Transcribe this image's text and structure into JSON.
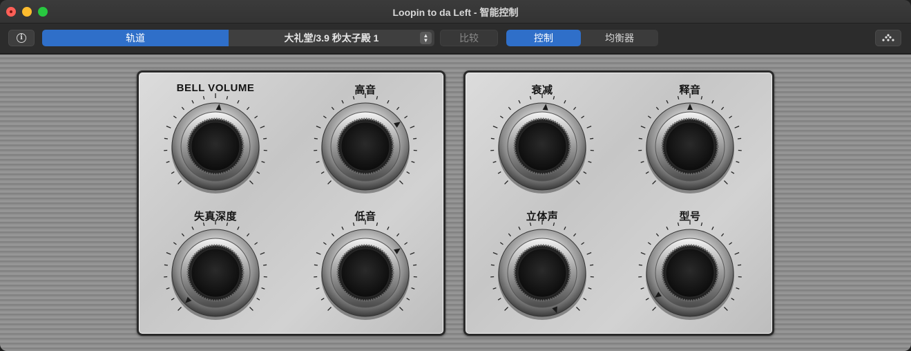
{
  "window": {
    "title": "Loopin to da Left - 智能控制"
  },
  "toolbar": {
    "info_label": "i",
    "track_label": "轨道",
    "preset_value": "大礼堂/3.9 秒太子殿 1",
    "compare_label": "比较",
    "tabs": [
      {
        "label": "控制",
        "active": true
      },
      {
        "label": "均衡器",
        "active": false
      }
    ]
  },
  "panels": [
    {
      "knobs": [
        {
          "label": "BELL VOLUME",
          "pointer_angle": 5
        },
        {
          "label": "高音",
          "pointer_angle": 55
        },
        {
          "label": "失真深度",
          "pointer_angle": -135
        },
        {
          "label": "低音",
          "pointer_angle": 55
        }
      ]
    },
    {
      "knobs": [
        {
          "label": "衰减",
          "pointer_angle": 5
        },
        {
          "label": "释音",
          "pointer_angle": 0
        },
        {
          "label": "立体声",
          "pointer_angle": 160
        },
        {
          "label": "型号",
          "pointer_angle": -125
        }
      ]
    }
  ],
  "colors": {
    "accent": "#2f6fc9",
    "panel": "#d0d0d0",
    "knob_cap": "#1a1a1a"
  }
}
